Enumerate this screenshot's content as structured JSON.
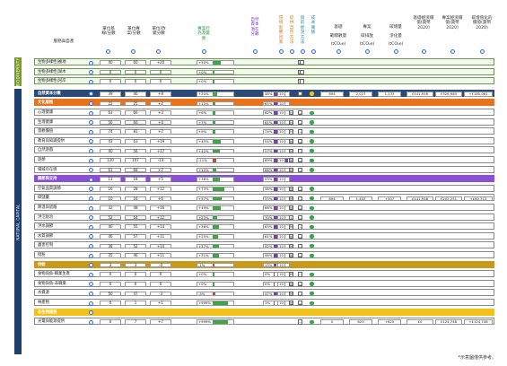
{
  "header": {
    "col_name": "服務與自產",
    "col_base": "單位基線/分數",
    "col_score": "單位專案/分數",
    "col_change": "單位/改變分數",
    "col_event": "專案行為及變異",
    "col_nature": "自然資本潛在分數",
    "col_v1": "環境影響因素",
    "col_v2": "提供自然方法",
    "col_v3": "目前狀況方法",
    "col_v4": "成本風險",
    "col_b1": "基礎",
    "col_b1b": "範疇數量",
    "col_b1c": "(tCO₂e)",
    "col_b2": "專案",
    "col_b2b": "碳排放",
    "col_b2c": "(tCO₂e)",
    "col_b3": "碳增量",
    "col_b3b": "淨化量",
    "col_b3c": "(tCO₂e)",
    "col_b4": "基礎經濟價值(貨幣2020)",
    "col_b5": "專案經濟價值(貨幣2020)",
    "col_b6": "碳增值化的價值(貨幣2020)"
  },
  "bands": {
    "biodiversity": "BIODIVERSITY",
    "natural": "NATURAL CAPITAL"
  },
  "bio_rows": [
    {
      "name": "生物多樣性|複地",
      "base": "40",
      "score": "60",
      "change": "+20",
      "pct": "+50%",
      "fill": 50
    },
    {
      "name": "生物多樣性|湖木",
      "base": "0",
      "score": "0",
      "change": "0",
      "pct": "+0%",
      "fill": 0
    },
    {
      "name": "生物多樣性|河岸",
      "base": "0",
      "score": "0",
      "change": "0",
      "pct": "+0%",
      "fill": 0
    }
  ],
  "total_row": {
    "name": "自然資本分數",
    "base": "39",
    "score": "46",
    "change": "+8",
    "pct": "+20%",
    "fill": 20,
    "nat": "48%",
    "natfill": 48,
    "v1": "10",
    "b1": "894",
    "b2": "2,027",
    "b3": "1,133",
    "b4": "£141,918",
    "b5": "£326,980",
    "b6": "+£185,061"
  },
  "sections": [
    {
      "title": "文化服務",
      "color": "#e8731c",
      "base": "22",
      "score": "25",
      "change": "+2",
      "pct": "+10%",
      "fill": 10,
      "nat": "65%",
      "natfill": 65,
      "v1": "10",
      "rows": [
        {
          "name": "心理健康",
          "base": "63",
          "score": "66",
          "change": "+3",
          "pct": "+6%",
          "fill": 6,
          "nat": "62%",
          "natfill": 62,
          "v1": "10",
          "v2": "H"
        },
        {
          "name": "生理健康",
          "base": "56",
          "score": "60",
          "change": "+4",
          "pct": "+7%",
          "fill": 7,
          "nat": "61%",
          "natfill": 61,
          "v1": "10",
          "v2": "H"
        },
        {
          "name": "景觀價值",
          "base": "74",
          "score": "81",
          "change": "+7",
          "pct": "+9%",
          "fill": 9,
          "nat": "74%",
          "natfill": 74,
          "v1": "10",
          "v2": "H"
        },
        {
          "name": "教育與知識提供",
          "base": "43",
          "score": "63",
          "change": "+19",
          "pct": "+45%",
          "fill": 45,
          "nat": "54%",
          "natfill": 54,
          "v1": "10",
          "v2": "M"
        },
        {
          "name": "自然遊戲",
          "base": "40",
          "score": "56",
          "change": "+17",
          "pct": "+42%",
          "fill": 42,
          "nat": "57%",
          "natfill": 57,
          "v1": "10",
          "v2": "M"
        },
        {
          "name": "遊憩",
          "base": "120",
          "score": "107",
          "change": "-13",
          "pct": "-11%",
          "fill": 11,
          "nat": "89%",
          "natfill": 89,
          "v1": "10",
          "v2": "M"
        },
        {
          "name": "場域存在感",
          "base": "61",
          "score": "68",
          "change": "+7",
          "pct": "+12%",
          "fill": 12,
          "nat": "66%",
          "natfill": 66,
          "v1": "10",
          "v2": "M"
        }
      ]
    },
    {
      "title": "調節與支持",
      "color": "#8a4fd6",
      "base": "13",
      "score": "18",
      "change": "+5",
      "pct": "+38%",
      "fill": 38,
      "nat": "53%",
      "natfill": 53,
      "v1": "10",
      "rows": [
        {
          "name": "空氣品質調節",
          "base": "16",
          "score": "28",
          "change": "+12",
          "pct": "+73%",
          "fill": 73,
          "nat": "38%",
          "natfill": 38,
          "v1": "10",
          "v2": "M"
        },
        {
          "name": "碳儲量",
          "base": "10",
          "score": "16",
          "change": "+6",
          "pct": "+57%",
          "fill": 57,
          "nat": "33%",
          "natfill": 33,
          "v1": "10",
          "v2": "M",
          "b1": "894",
          "b2": "1,402",
          "b3": "+507",
          "b4": "£141,918",
          "b5": "£202,251",
          "b6": "+£60,313"
        },
        {
          "name": "降溫與遮蔭",
          "base": "32",
          "score": "48",
          "change": "+16",
          "pct": "+49%",
          "fill": 49,
          "nat": "66%",
          "natfill": 66,
          "v1": "10",
          "v2": "M"
        },
        {
          "name": "洪氾防治",
          "base": "52",
          "score": "64",
          "change": "+12",
          "pct": "+23%",
          "fill": 23,
          "nat": "70%",
          "natfill": 70,
          "v1": "10",
          "v2": "L"
        },
        {
          "name": "洪水調節",
          "base": "40",
          "score": "55",
          "change": "+14",
          "pct": "+36%",
          "fill": 36,
          "nat": "63%",
          "natfill": 63,
          "v1": "10",
          "v2": "M"
        },
        {
          "name": "水質調節",
          "base": "46",
          "score": "57",
          "change": "+11",
          "pct": "+25%",
          "fill": 25,
          "nat": "61%",
          "natfill": 61,
          "v1": "10",
          "v2": "M"
        },
        {
          "name": "蟲害控制",
          "base": "38",
          "score": "52",
          "change": "+14",
          "pct": "+37%",
          "fill": 37,
          "nat": "52%",
          "natfill": 52,
          "v1": "10",
          "v2": "M"
        },
        {
          "name": "授粉",
          "base": "35",
          "score": "46",
          "change": "+11",
          "pct": "+31%",
          "fill": 31,
          "nat": "46%",
          "natfill": 46,
          "v1": "10",
          "v2": "M"
        }
      ]
    },
    {
      "title": "供給",
      "color": "#c99a1a",
      "base": "3",
      "score": "3",
      "change": "-0",
      "pct": "-1%",
      "fill": 1,
      "nat": "13%",
      "natfill": 13,
      "v1": "10",
      "rows": [
        {
          "name": "食物與魚-職業生產",
          "base": "0",
          "score": "0",
          "change": "0",
          "pct": "+0%",
          "fill": 0,
          "nat": "0%",
          "natfill": 0,
          "v1": "10",
          "v2": "M"
        },
        {
          "name": "食物與魚-非職業",
          "base": "0",
          "score": "0",
          "change": "0",
          "pct": "+0%",
          "fill": 0,
          "nat": "0%",
          "natfill": 0,
          "v1": "10",
          "v2": "M"
        },
        {
          "name": "水資源",
          "base": "50",
          "score": "47",
          "change": "-3",
          "pct": "-5%",
          "fill": 5,
          "nat": "47%",
          "natfill": 47,
          "v1": "10",
          "v2": "M"
        },
        {
          "name": "林產物",
          "base": "0",
          "score": "1",
          "change": "+1",
          "pct": "+999%",
          "fill": 100,
          "nat": "1%",
          "natfill": 1,
          "v1": "10",
          "v2": "M"
        }
      ]
    },
    {
      "title": "非生物服務",
      "color": "#f2c21a",
      "base": "",
      "score": "",
      "change": "",
      "pct": "",
      "fill": 0,
      "nat": "",
      "natfill": 0,
      "v1": "",
      "rows": [
        {
          "name": "光電與能源提供",
          "base": "0",
          "score": "7",
          "change": "+7",
          "pct": "+999%",
          "fill": 100,
          "nat": "",
          "natfill": 0,
          "v1": "",
          "v2": "",
          "b1": "0",
          "b2": "625",
          "b3": "+625",
          "b4": "£0",
          "b5": "£124,748",
          "b6": "+£124,748"
        }
      ]
    }
  ],
  "footer": "*示意圖僅供參考。"
}
